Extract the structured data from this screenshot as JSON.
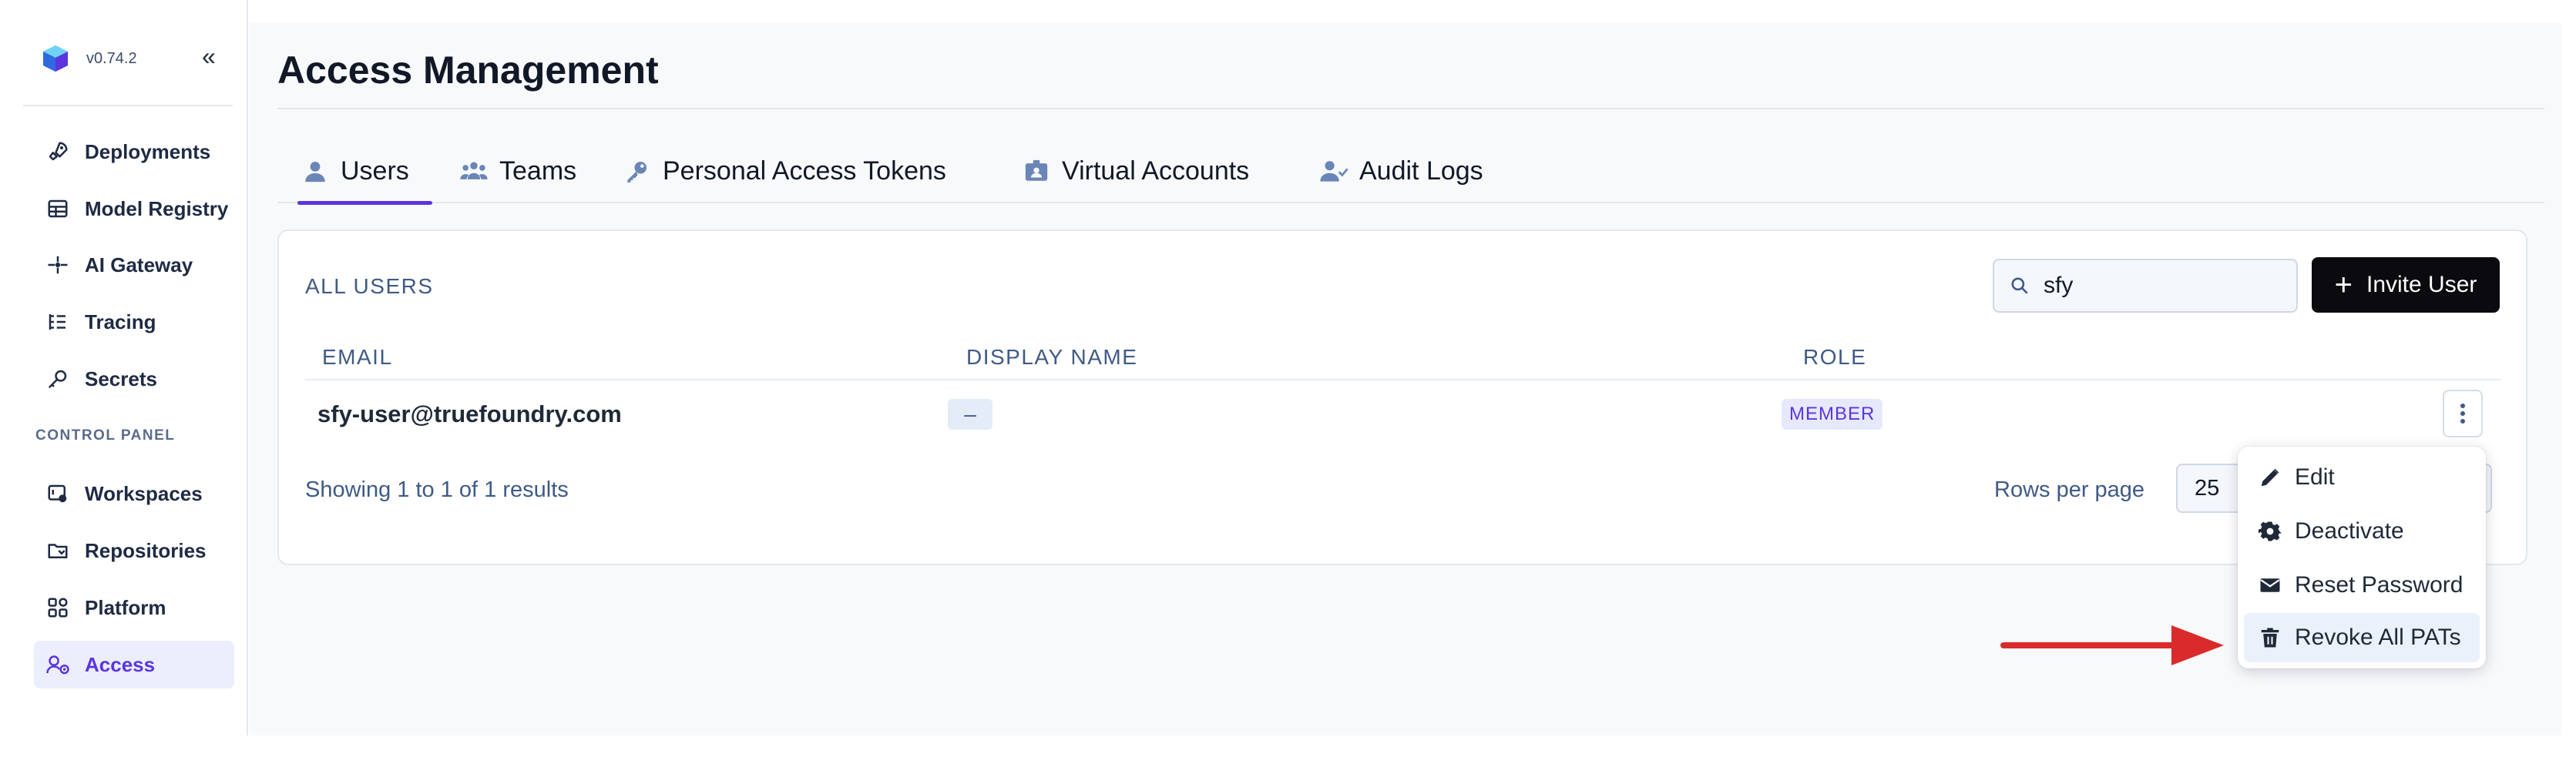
{
  "app": {
    "version": "v0.74.2"
  },
  "sidebar": {
    "items": [
      {
        "label": "Deployments",
        "icon": "rocket-icon"
      },
      {
        "label": "Model Registry",
        "icon": "table-icon"
      },
      {
        "label": "AI Gateway",
        "icon": "gateway-icon"
      },
      {
        "label": "Tracing",
        "icon": "tracing-icon"
      },
      {
        "label": "Secrets",
        "icon": "key-icon"
      }
    ],
    "section_label": "CONTROL PANEL",
    "control_items": [
      {
        "label": "Workspaces",
        "icon": "workspaces-icon"
      },
      {
        "label": "Repositories",
        "icon": "repositories-icon"
      },
      {
        "label": "Platform",
        "icon": "platform-icon"
      },
      {
        "label": "Access",
        "icon": "access-icon",
        "active": true
      }
    ]
  },
  "page": {
    "title": "Access Management"
  },
  "tabs": [
    {
      "label": "Users",
      "icon": "user-icon",
      "active": true
    },
    {
      "label": "Teams",
      "icon": "teams-icon"
    },
    {
      "label": "Personal Access Tokens",
      "icon": "key-icon"
    },
    {
      "label": "Virtual Accounts",
      "icon": "badge-icon"
    },
    {
      "label": "Audit Logs",
      "icon": "user-check-icon"
    }
  ],
  "users": {
    "section_title": "ALL USERS",
    "search": {
      "value": "sfy",
      "placeholder": ""
    },
    "invite_label": "Invite User",
    "columns": [
      "EMAIL",
      "DISPLAY NAME",
      "ROLE"
    ],
    "rows": [
      {
        "email": "sfy-user@truefoundry.com",
        "display_name": "–",
        "role": "MEMBER"
      }
    ],
    "showing": "Showing 1 to 1 of 1 results",
    "rows_per_page_label": "Rows per page",
    "rows_per_page": "25"
  },
  "menu": {
    "items": [
      {
        "label": "Edit",
        "icon": "pencil-icon"
      },
      {
        "label": "Deactivate",
        "icon": "gear-icon"
      },
      {
        "label": "Reset Password",
        "icon": "envelope-icon"
      },
      {
        "label": "Revoke All PATs",
        "icon": "trash-icon",
        "highlighted": true
      }
    ]
  },
  "colors": {
    "accent": "#5b35e0",
    "annotation_arrow": "#d92b2b",
    "primary_button": "#0b0b0f"
  }
}
